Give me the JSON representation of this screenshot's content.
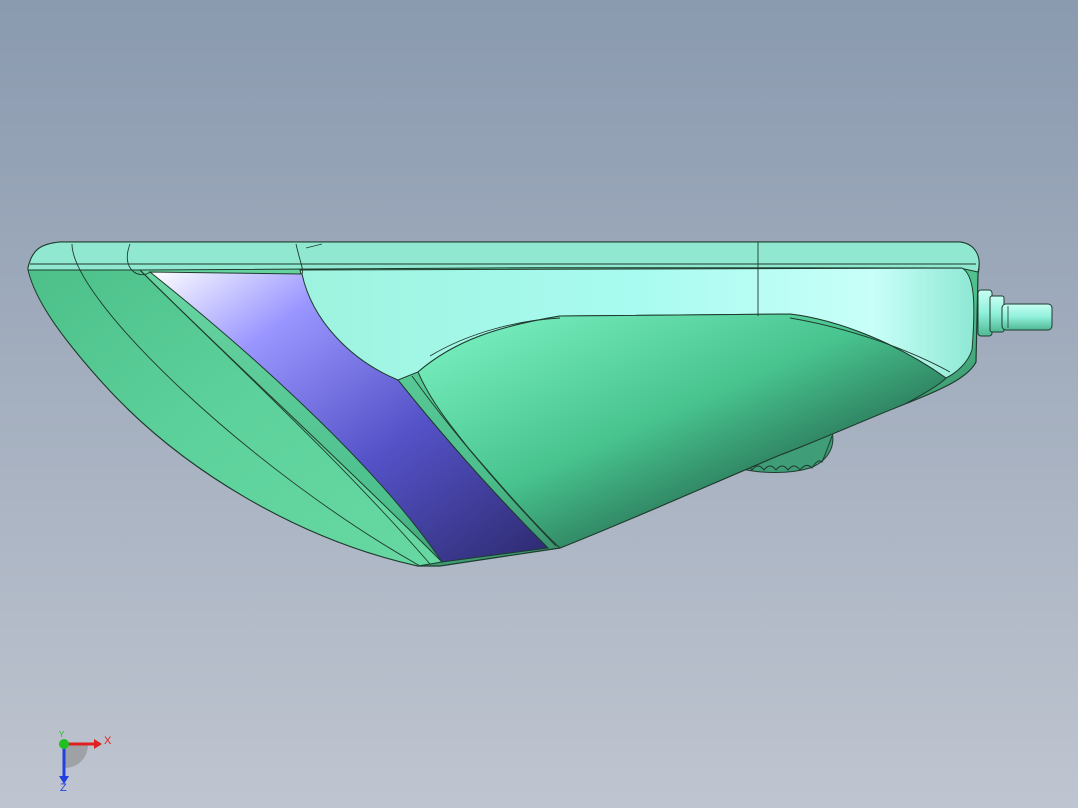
{
  "viewport": {
    "background_top": "#8a9aaf",
    "background_bottom": "#bfc5d0"
  },
  "model": {
    "body_color": "#5ecf9a",
    "top_face_color": "#a8f5ec",
    "stripe_color": "#5c5ad0",
    "highlight_color": "#ffffff",
    "edge_color": "#1f3b2e"
  },
  "triad": {
    "x_label": "X",
    "y_label": "Y",
    "z_label": "Z",
    "x_color": "#e02020",
    "y_color": "#20c020",
    "z_color": "#2040e0"
  }
}
